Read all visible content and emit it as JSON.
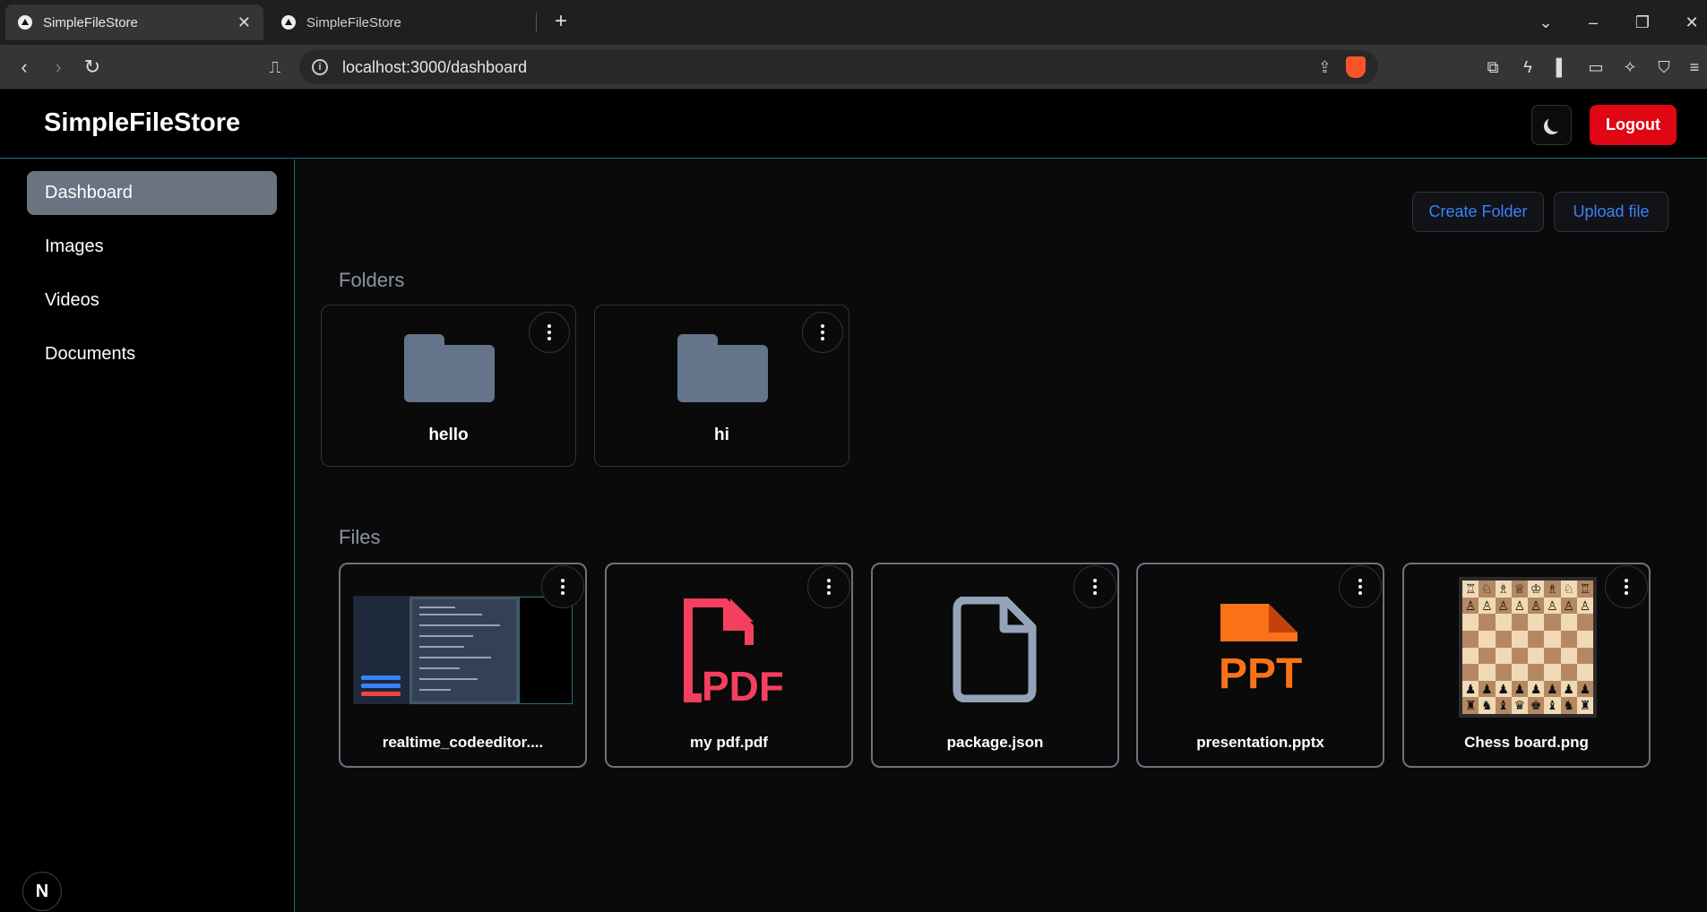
{
  "browser": {
    "tabs": [
      {
        "title": "SimpleFileStore",
        "active": true
      },
      {
        "title": "SimpleFileStore",
        "active": false
      }
    ],
    "url": "localhost:3000/dashboard"
  },
  "header": {
    "brand": "SimpleFileStore",
    "logout_label": "Logout"
  },
  "sidebar": {
    "items": [
      {
        "label": "Dashboard",
        "active": true
      },
      {
        "label": "Images",
        "active": false
      },
      {
        "label": "Videos",
        "active": false
      },
      {
        "label": "Documents",
        "active": false
      }
    ],
    "badge": "N"
  },
  "main": {
    "create_folder_label": "Create Folder",
    "upload_file_label": "Upload file",
    "folders_title": "Folders",
    "files_title": "Files",
    "folders": [
      {
        "name": "hello"
      },
      {
        "name": "hi"
      }
    ],
    "files": [
      {
        "name": "realtime_codeeditor....",
        "icon": "image-thumbnail"
      },
      {
        "name": "my pdf.pdf",
        "icon": "pdf-icon"
      },
      {
        "name": "package.json",
        "icon": "file-icon"
      },
      {
        "name": "presentation.pptx",
        "icon": "ppt-icon"
      },
      {
        "name": "Chess board.png",
        "icon": "image-thumbnail"
      }
    ],
    "pdf_icon_text": "PDF",
    "ppt_icon_text": "PPT"
  },
  "colors": {
    "accent": "#3b82f6",
    "logout": "#e10613",
    "pdf": "#f43f5e",
    "ppt": "#f97316",
    "folder": "#64748b"
  }
}
